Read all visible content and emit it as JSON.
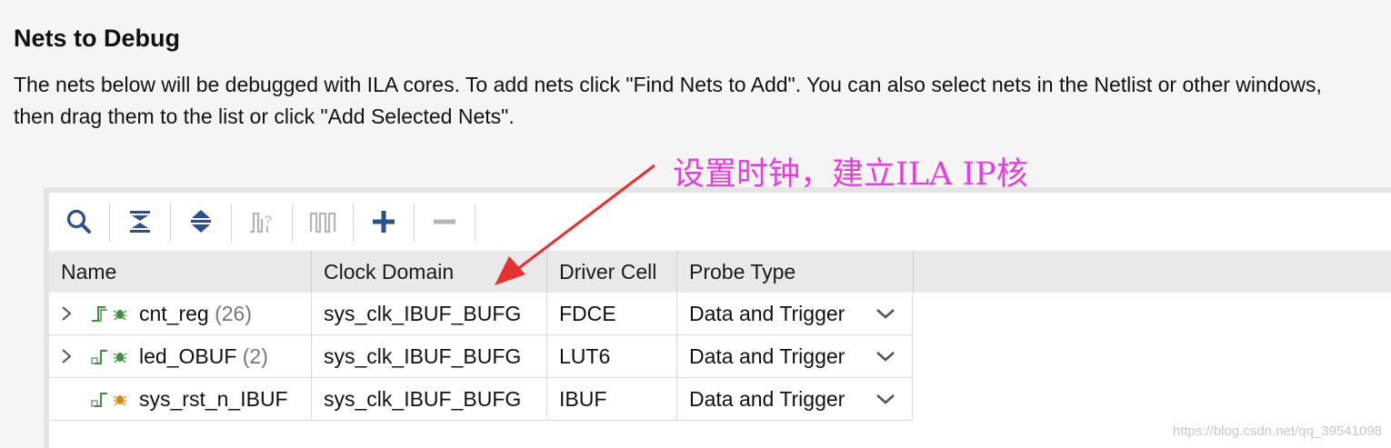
{
  "section": {
    "title": "Nets to Debug",
    "desc_line1": "The nets below will be debugged with ILA cores. To add nets click \"Find Nets to Add\". You can also select nets in the Netlist or other windows,",
    "desc_line2": "then drag them to the list or click \"Add Selected Nets\"."
  },
  "annotation": {
    "text": "设置时钟，建立ILA IP核",
    "color": "#e83ce0"
  },
  "toolbar": {
    "buttons": [
      {
        "icon": "search-icon",
        "enabled": true
      },
      {
        "icon": "collapse-all-icon",
        "enabled": true
      },
      {
        "icon": "expand-all-icon",
        "enabled": true
      },
      {
        "icon": "select-clock-icon",
        "enabled": false
      },
      {
        "icon": "waveform-icon",
        "enabled": false
      },
      {
        "icon": "add-icon",
        "enabled": true
      },
      {
        "icon": "remove-icon",
        "enabled": false
      }
    ]
  },
  "table": {
    "columns": [
      "Name",
      "Clock Domain",
      "Driver Cell",
      "Probe Type"
    ],
    "rows": [
      {
        "name": "cnt_reg",
        "count": "(26)",
        "clock": "sys_clk_IBUF_BUFG",
        "driver": "FDCE",
        "probe": "Data and Trigger"
      },
      {
        "name": "led_OBUF",
        "count": "(2)",
        "clock": "sys_clk_IBUF_BUFG",
        "driver": "LUT6",
        "probe": "Data and Trigger"
      },
      {
        "name": "sys_rst_n_IBUF",
        "count": "",
        "clock": "sys_clk_IBUF_BUFG",
        "driver": "IBUF",
        "probe": "Data and Trigger"
      }
    ]
  },
  "watermark": "https://blog.csdn.net/qq_39541098",
  "colors": {
    "icon_blue": "#2d4f8c",
    "icon_disabled": "#b5b5b5",
    "bug_green": "#3f8f3f",
    "bug_orange": "#d98a1a",
    "arrow_red": "#e83030"
  }
}
